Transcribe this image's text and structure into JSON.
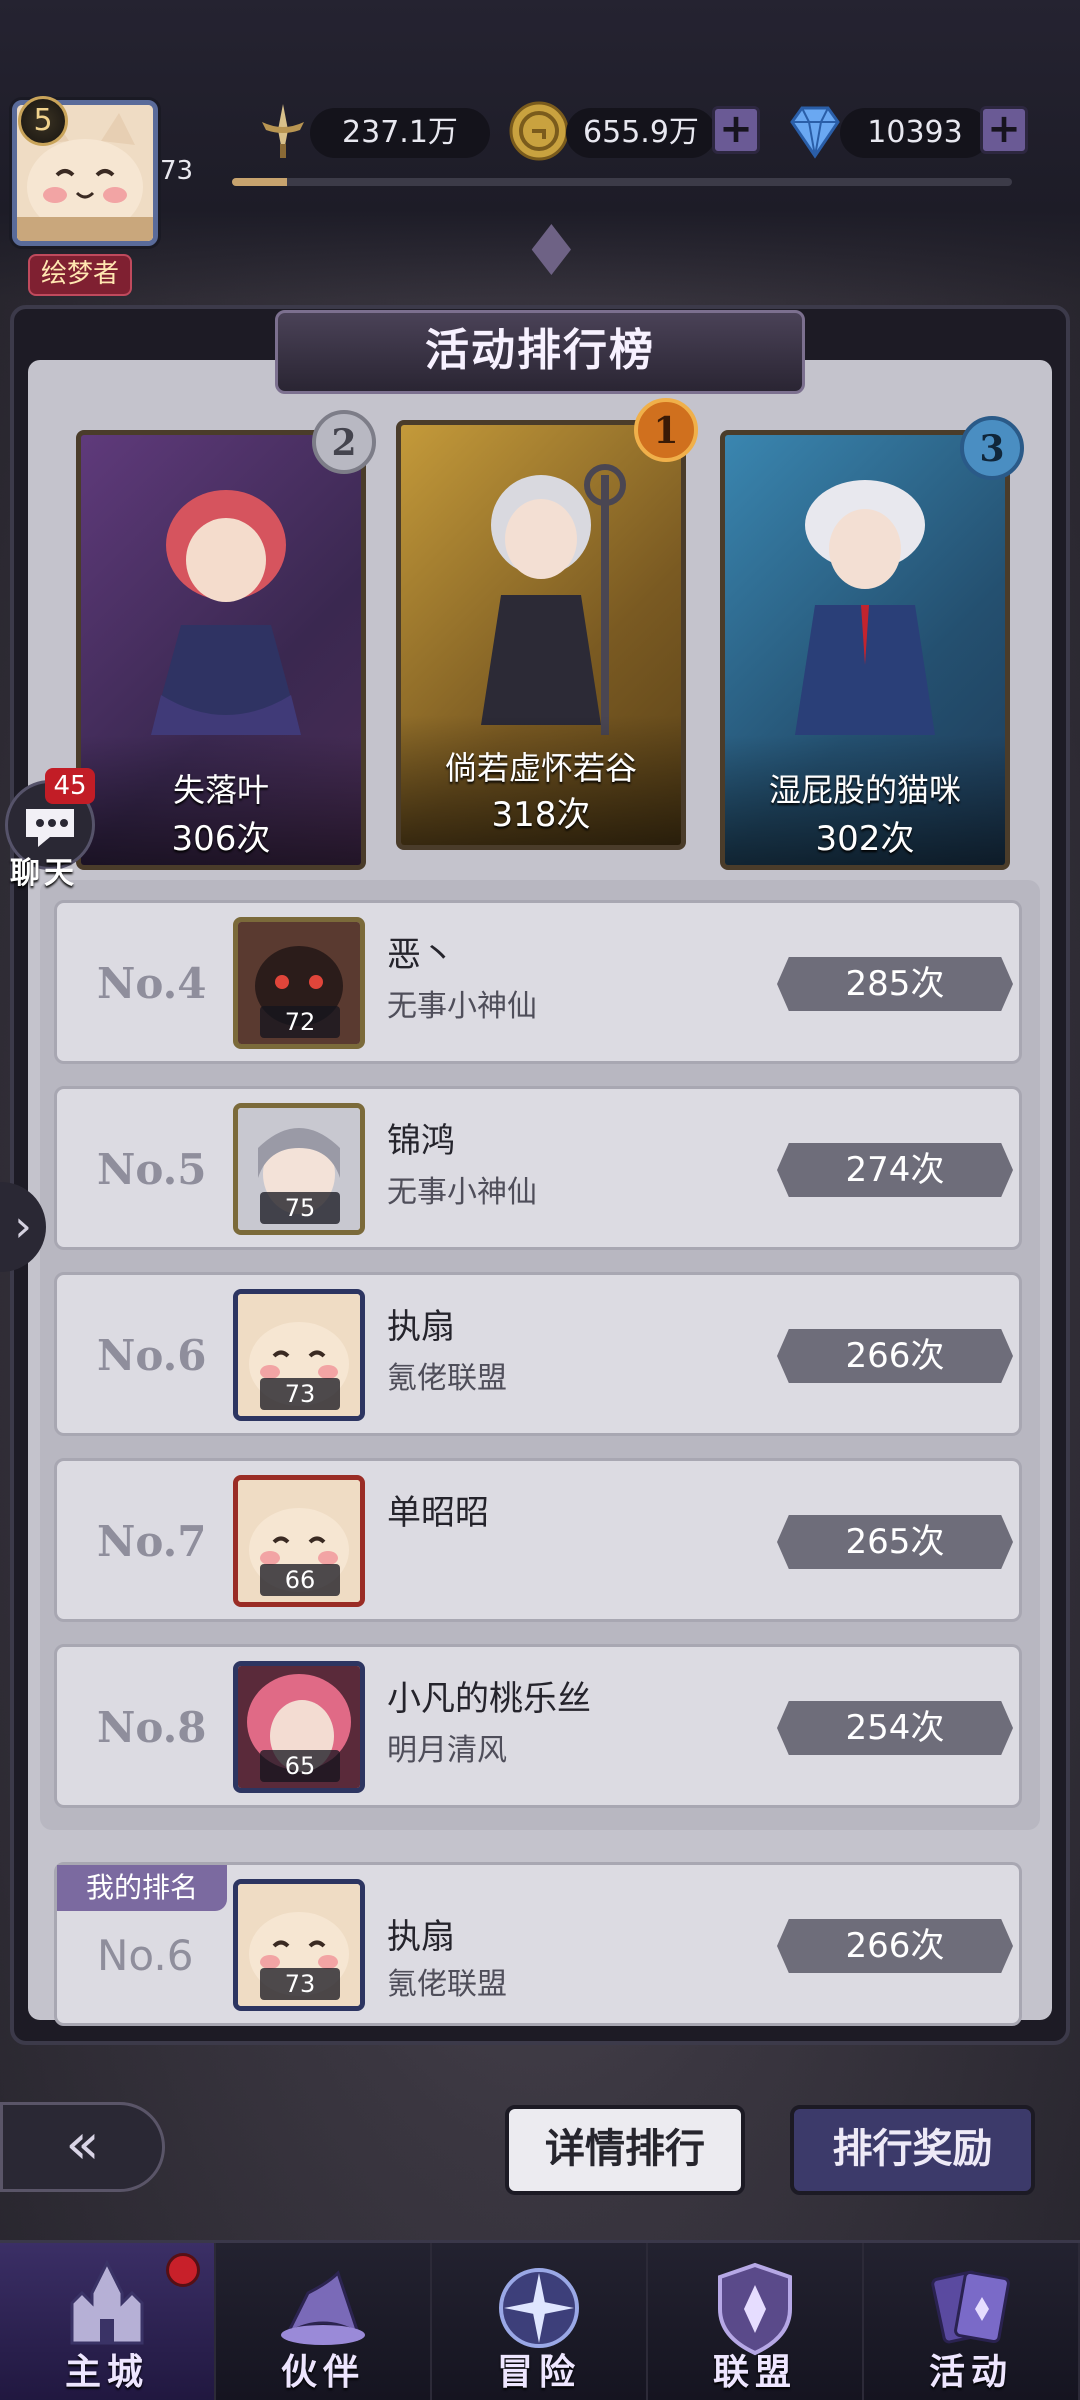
{
  "hud": {
    "player_level": "5",
    "avatar_level": "73",
    "title_tag": "绘梦者",
    "xp_progress": 0.07,
    "power": "237.1万",
    "gold": "655.9万",
    "diamonds": "10393"
  },
  "panel": {
    "title": "活动排行榜"
  },
  "top3": [
    {
      "rank": "2",
      "name": "失落叶",
      "count": "306次"
    },
    {
      "rank": "1",
      "name": "倘若虚怀若谷",
      "count": "318次"
    },
    {
      "rank": "3",
      "name": "湿屁股的猫咪",
      "count": "302次"
    }
  ],
  "rows": [
    {
      "rank": "No.4",
      "name": "恶丶",
      "guild": "无事小神仙",
      "level": "72",
      "count": "285次"
    },
    {
      "rank": "No.5",
      "name": "锦鸿",
      "guild": "无事小神仙",
      "level": "75",
      "count": "274次"
    },
    {
      "rank": "No.6",
      "name": "执扇",
      "guild": "氪佬联盟",
      "level": "73",
      "count": "266次"
    },
    {
      "rank": "No.7",
      "name": "单昭昭",
      "guild": "",
      "level": "66",
      "count": "265次"
    },
    {
      "rank": "No.8",
      "name": "小凡的桃乐丝",
      "guild": "明月清风",
      "level": "65",
      "count": "254次"
    }
  ],
  "my_rank": {
    "tag": "我的排名",
    "rank": "No.6",
    "name": "执扇",
    "guild": "氪佬联盟",
    "level": "73",
    "count": "266次"
  },
  "buttons": {
    "detail": "详情排行",
    "reward": "排行奖励"
  },
  "chat": {
    "badge": "45",
    "label": "聊天"
  },
  "nav": [
    {
      "label": "主城",
      "icon": "castle-icon"
    },
    {
      "label": "伙伴",
      "icon": "witch-hat-icon"
    },
    {
      "label": "冒险",
      "icon": "compass-icon"
    },
    {
      "label": "联盟",
      "icon": "shield-icon"
    },
    {
      "label": "活动",
      "icon": "cards-icon"
    }
  ]
}
